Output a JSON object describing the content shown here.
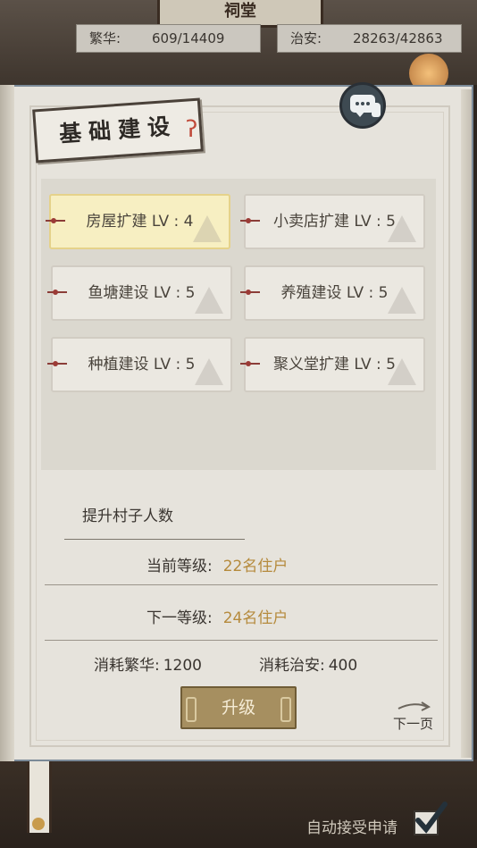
{
  "background": {
    "sign_text": "祠堂"
  },
  "stats": {
    "prosperity": {
      "label": "繁华:",
      "value": "609/14409"
    },
    "security": {
      "label": "治安:",
      "value": "28263/42863"
    }
  },
  "panel": {
    "title": "基础建设"
  },
  "buildings": [
    {
      "label": "房屋扩建 LV : 4",
      "selected": true
    },
    {
      "label": "小卖店扩建 LV : 5",
      "selected": false
    },
    {
      "label": "鱼塘建设 LV : 5",
      "selected": false
    },
    {
      "label": "养殖建设 LV : 5",
      "selected": false
    },
    {
      "label": "种植建设 LV : 5",
      "selected": false
    },
    {
      "label": "聚义堂扩建 LV : 5",
      "selected": false
    }
  ],
  "detail": {
    "description": "提升村子人数",
    "current_level": {
      "label": "当前等级:",
      "value": "22名住户"
    },
    "next_level": {
      "label": "下一等级:",
      "value": "24名住户"
    },
    "cost_prosperity": {
      "label": "消耗繁华:",
      "value": "1200"
    },
    "cost_security": {
      "label": "消耗治安:",
      "value": "400"
    }
  },
  "actions": {
    "upgrade_label": "升级",
    "next_page_label": "下一页",
    "auto_accept_label": "自动接受申请",
    "auto_accept_checked": true
  },
  "colors": {
    "accent_value": "#b58a3c",
    "selected_fill": "#f7efc2",
    "button_fill": "#a68f60"
  }
}
